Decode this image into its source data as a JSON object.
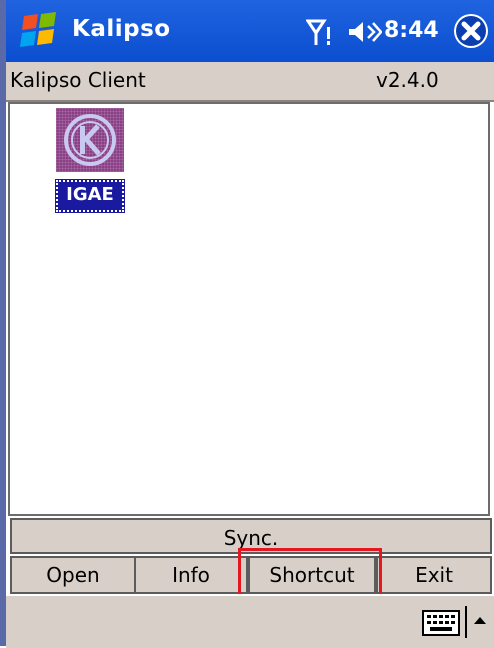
{
  "titlebar": {
    "title": "Kalipso",
    "time": "8:44"
  },
  "header": {
    "app_name": "Kalipso Client",
    "version": "v2.4.0"
  },
  "apps": [
    {
      "icon": "kalipso-k-logo-icon"
    },
    {
      "label": "IGAE",
      "icon": "igae-logo-icon"
    }
  ],
  "sync": {
    "label": "Sync."
  },
  "buttons": {
    "open": "Open",
    "info": "Info",
    "shortcut": "Shortcut",
    "exit": "Exit"
  },
  "colors": {
    "titlebar": "#0b4fd0",
    "chrome": "#d8d0c8",
    "highlight": "#e4161f"
  }
}
